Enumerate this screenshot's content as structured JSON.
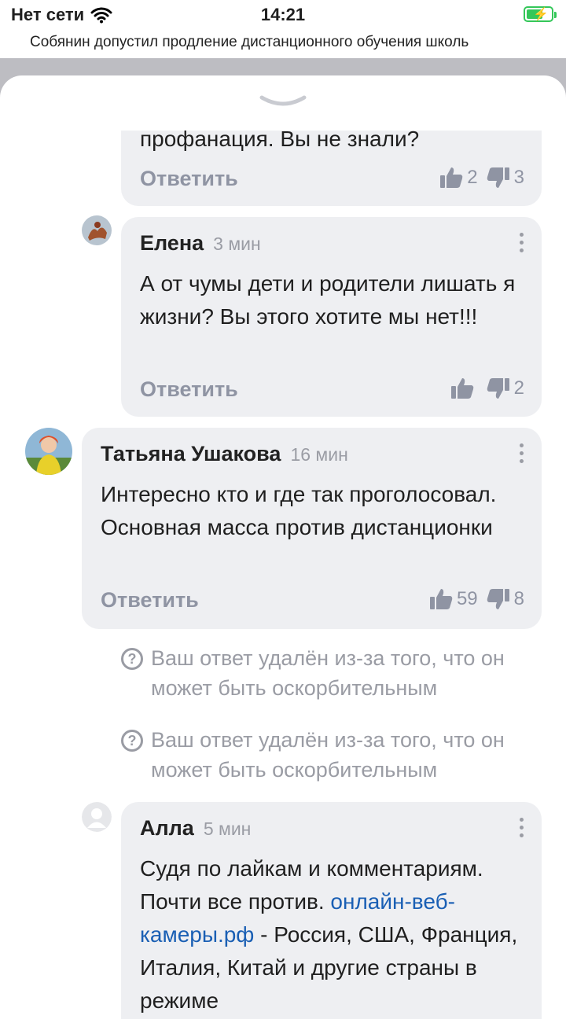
{
  "status_bar": {
    "network": "Нет сети",
    "time": "14:21"
  },
  "article_title": "Собянин допустил продление дистанционного обучения школь",
  "reply_label": "Ответить",
  "comments": [
    {
      "text": "профанация. Вы не знали?",
      "likes": "2",
      "dislikes": "3"
    },
    {
      "author": "Елена",
      "time": "3 мин",
      "text": "А от чумы дети и родители лишать я жизни? Вы этого хотите мы нет!!!",
      "likes": "",
      "dislikes": "2"
    },
    {
      "author": "Татьяна Ушакова",
      "time": "16 мин",
      "text": "Интересно кто и где так проголосовал. Основная масса против дистанционки",
      "likes": "59",
      "dislikes": "8"
    },
    {
      "author": "Алла",
      "time": "5 мин",
      "text_before_link": "Судя по лайкам и комментариям. Почти все против. ",
      "link": "онлайн-веб-камеры.рф",
      "text_after_link": " - Россия, США, Франция, Италия, Китай и другие страны в режиме"
    }
  ],
  "deleted_notices": [
    "Ваш ответ удалён из-за того, что он может быть оскорбительным",
    "Ваш ответ удалён из-за того, что он может быть оскорбительным"
  ],
  "icons": {
    "wifi": "wifi-icon",
    "battery": "battery-charging-icon",
    "like": "thumbs-up-icon",
    "dislike": "thumbs-down-icon",
    "menu": "more-vertical-icon",
    "deleted": "question-circle-icon",
    "avatar_placeholder": "user-placeholder-icon"
  },
  "colors": {
    "bubble": "#eeeff2",
    "muted": "#9a9ca4",
    "link": "#1a5fb4",
    "battery": "#34c759"
  }
}
